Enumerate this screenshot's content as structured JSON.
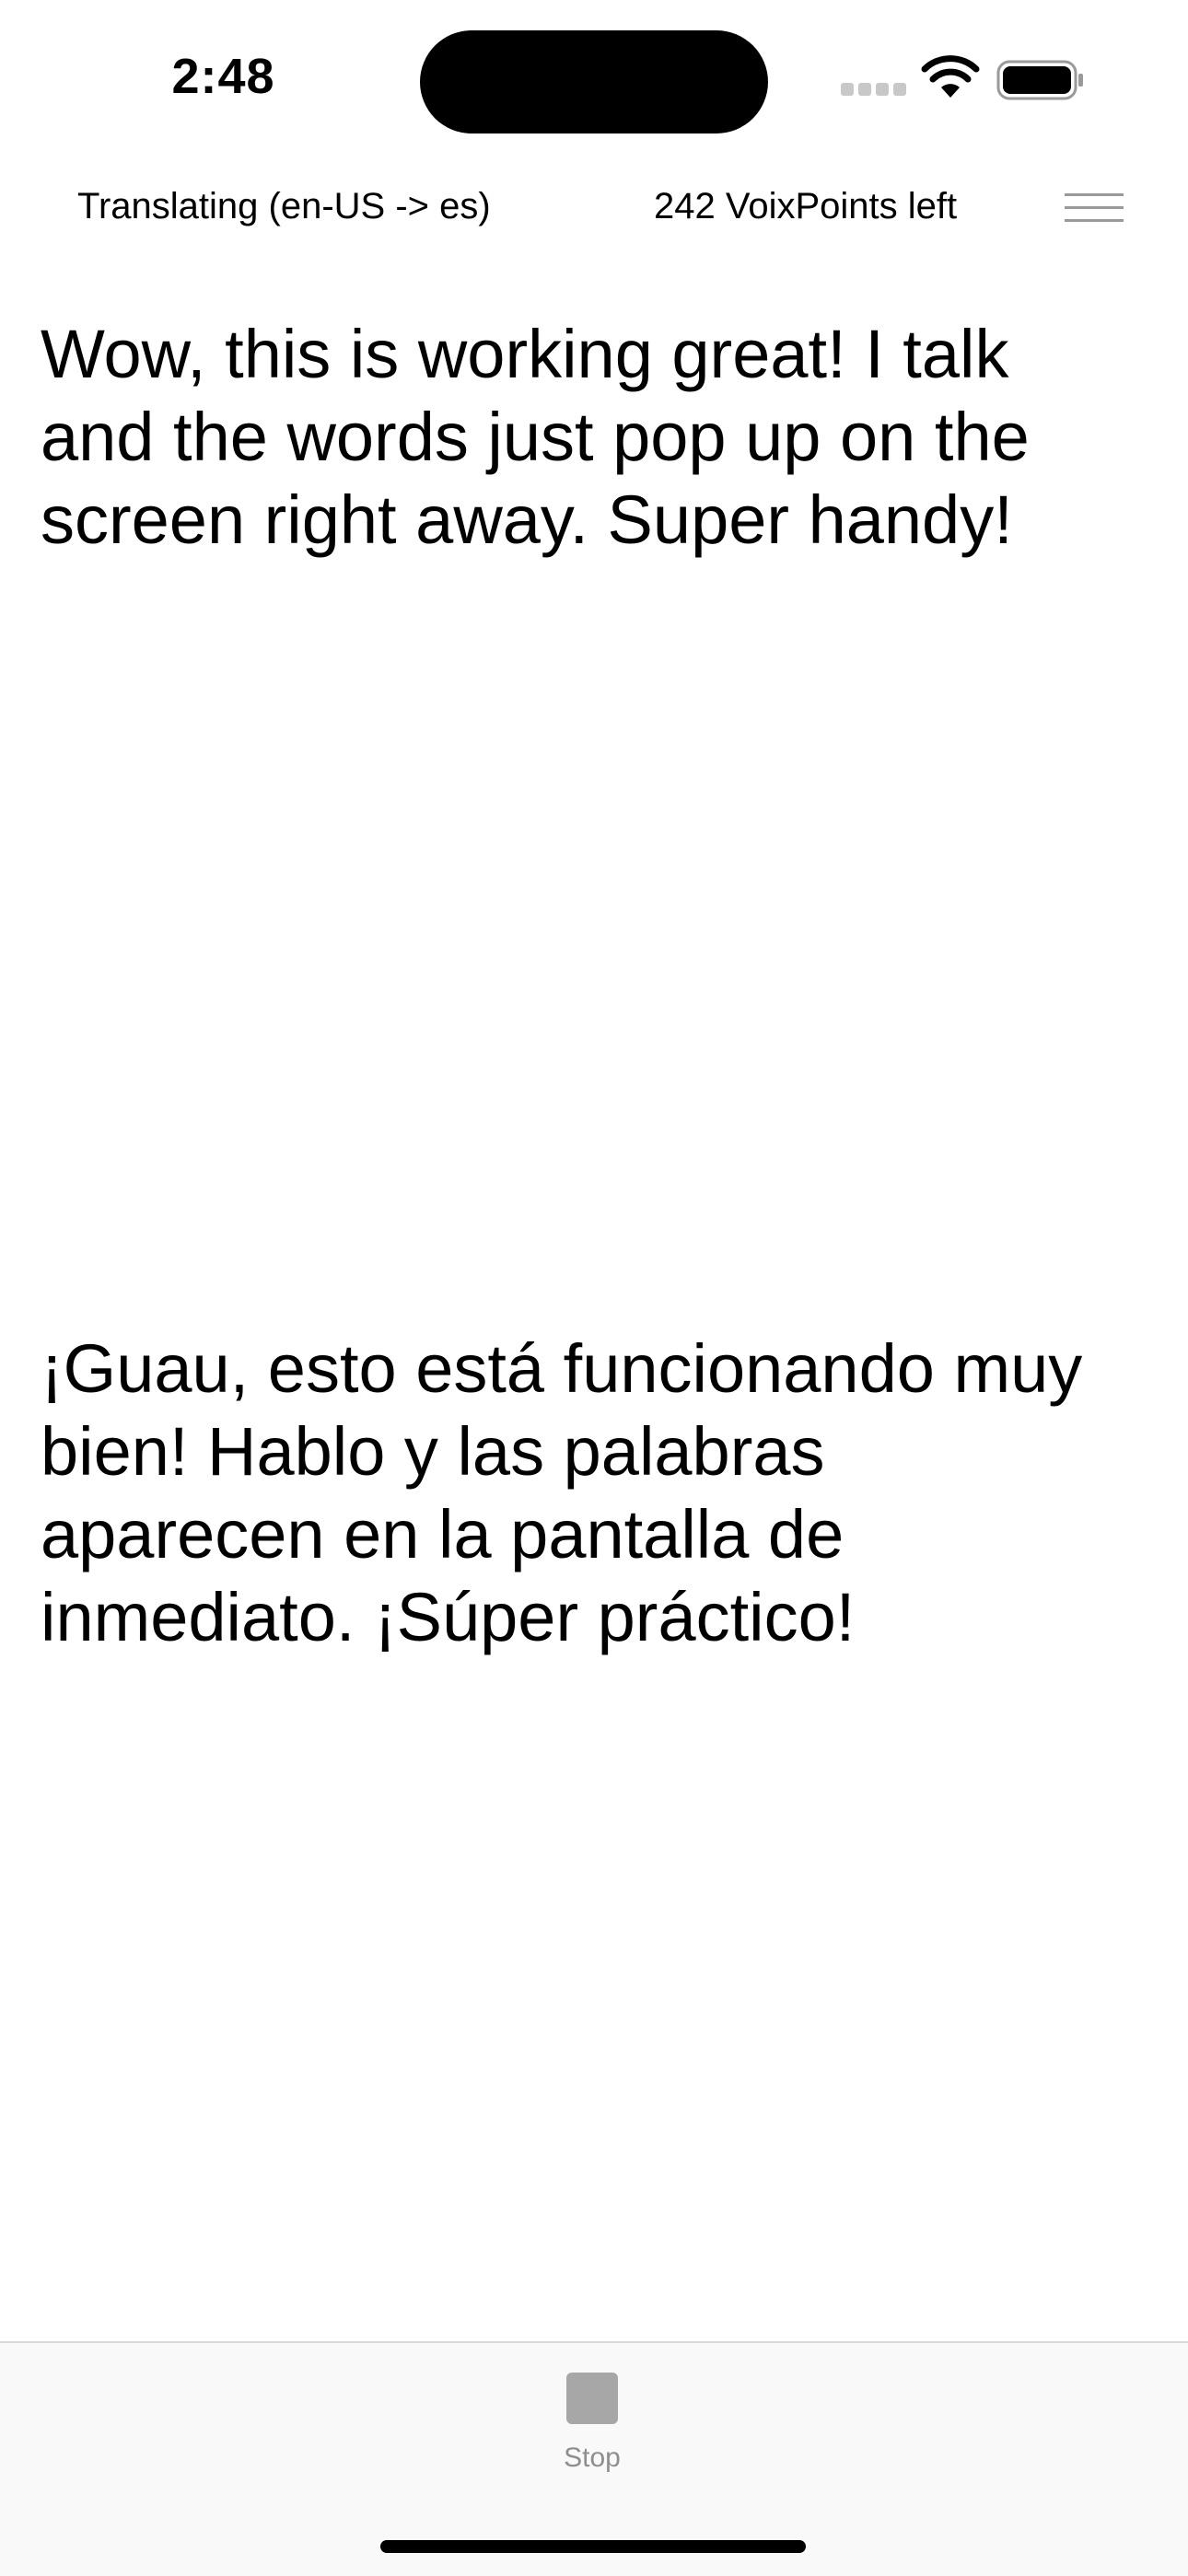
{
  "status_bar": {
    "time": "2:48",
    "signal_icon": "cellular-signal-icon",
    "wifi_icon": "wifi-icon",
    "battery_icon": "battery-icon"
  },
  "header": {
    "mode_label": "Translating (en-US -> es)",
    "points_label": "242 VoixPoints left",
    "menu_icon": "hamburger-menu-icon"
  },
  "transcript": {
    "source_text": "Wow, this is working great! I talk and the words just pop up on the screen right away. Super handy!",
    "translated_text": "¡Guau, esto está funcionando muy bien!  Hablo y las palabras aparecen en la pantalla de inmediato. ¡Súper práctico!"
  },
  "toolbar": {
    "stop_label": "Stop",
    "stop_icon": "stop-icon"
  },
  "colors": {
    "background": "#ffffff",
    "text": "#000000",
    "toolbar_background": "#f9f9f9",
    "muted_icon": "#a7a7a7",
    "muted_label": "#8e8e8e"
  }
}
